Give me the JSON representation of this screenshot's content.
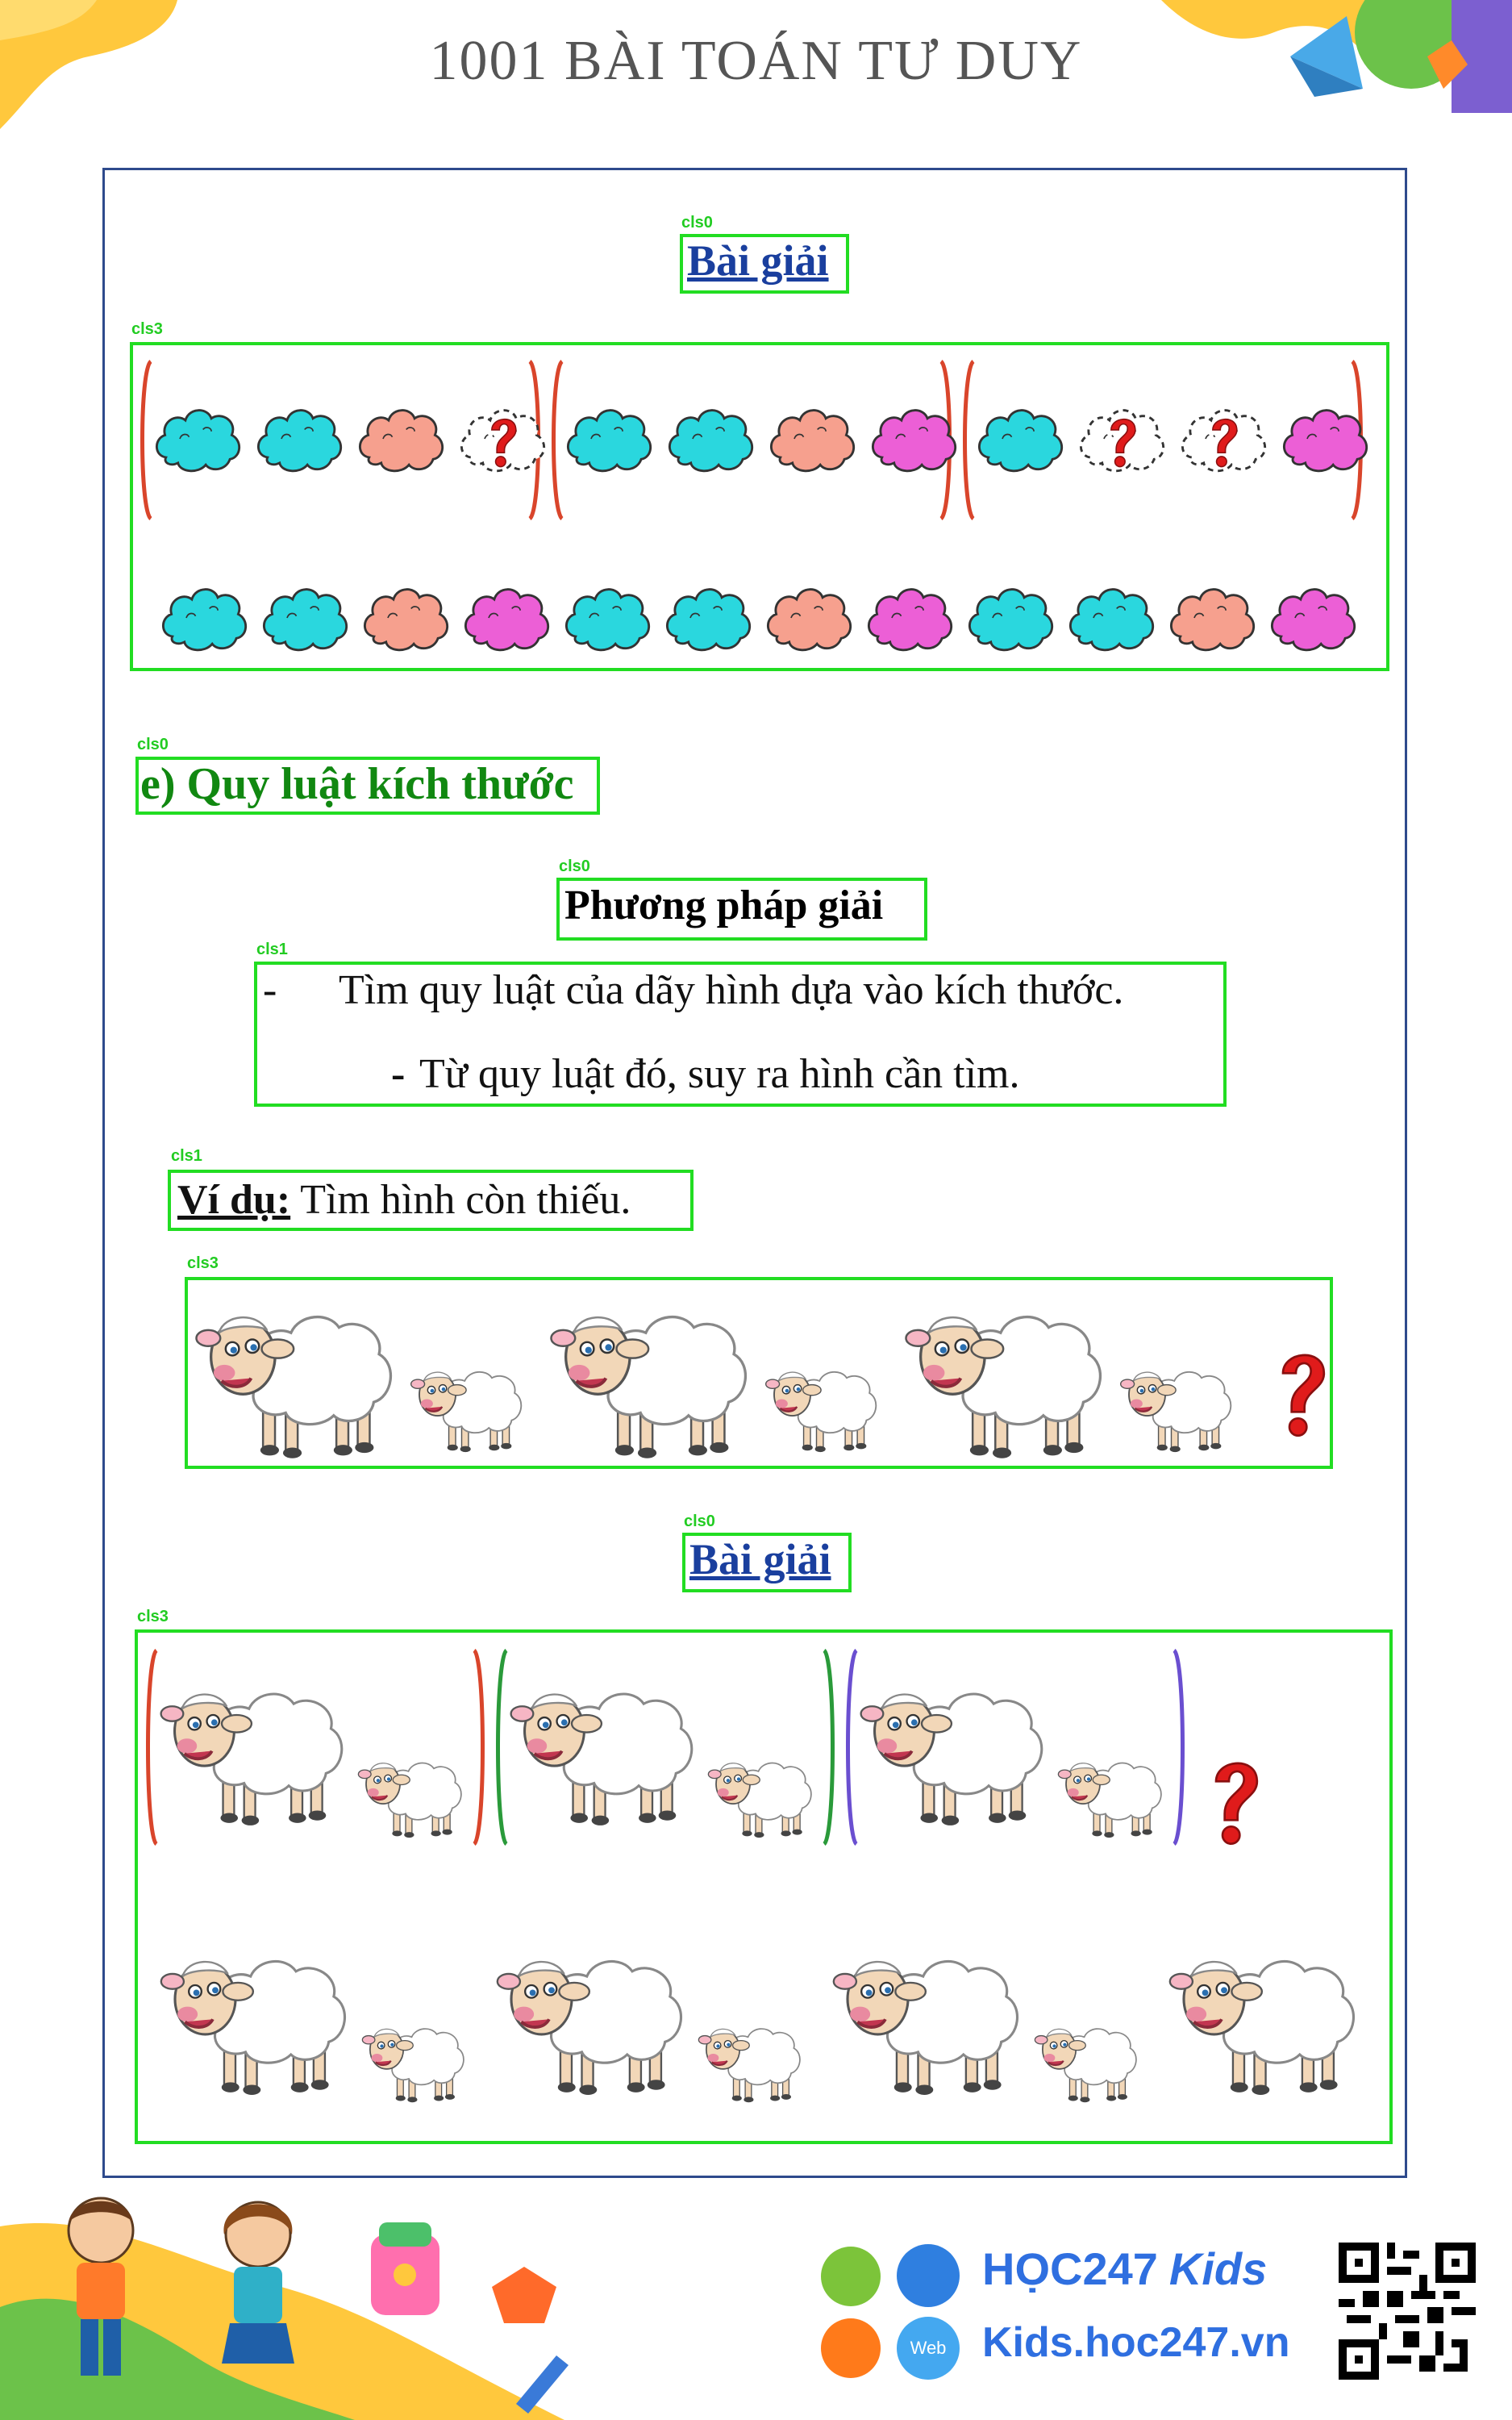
{
  "header": {
    "title": "1001 BÀI TOÁN TƯ DUY"
  },
  "section1": {
    "heading": "Bài giải"
  },
  "section2": {
    "heading": "e) Quy luật kích thước",
    "method_title": "Phương pháp giải",
    "steps": [
      {
        "bullet": "-",
        "text": "Tìm quy luật của dãy hình dựa vào kích thước."
      },
      {
        "bullet": "-",
        "text": "Từ quy luật đó, suy ra hình cần tìm."
      }
    ],
    "example_label": "Ví dụ:",
    "example_text": " Tìm hình còn thiếu.",
    "solution_heading": "Bài giải"
  },
  "box_labels": {
    "l0": "cls0",
    "l1": "cls3",
    "l2": "cls0",
    "l3": "cls0",
    "l4": "cls1",
    "l5": "cls1",
    "l6": "cls3",
    "l7": "cls0",
    "l8": "cls3"
  },
  "question_mark": "?",
  "footer": {
    "brand_prefix": "HỌC247",
    "brand_suffix": "Kids",
    "website": "Kids.hoc247.vn",
    "web_badge": "Web"
  },
  "colors": {
    "cyan": "#2ad7de",
    "salmon": "#f6a08e",
    "magenta": "#ec5fd6",
    "bracket_red": "#d9452b",
    "bracket_green": "#2a9a3a",
    "bracket_purple": "#6a4fd0",
    "box_green": "#22dd22"
  },
  "cloud_pattern": {
    "top_rows": [
      [
        "cyan",
        "cyan",
        "salmon",
        "?"
      ],
      [
        "cyan",
        "cyan",
        "salmon",
        "magenta"
      ],
      [
        "cyan",
        "?",
        "?",
        "magenta"
      ]
    ],
    "answer_row": [
      "cyan",
      "cyan",
      "salmon",
      "magenta",
      "cyan",
      "cyan",
      "salmon",
      "magenta",
      "cyan",
      "cyan",
      "salmon",
      "magenta"
    ]
  },
  "sheep_pattern": {
    "example": [
      "big",
      "small",
      "big",
      "small",
      "big",
      "small",
      "?"
    ],
    "solution_groups": [
      [
        "big",
        "small"
      ],
      [
        "big",
        "small"
      ],
      [
        "big",
        "small"
      ]
    ],
    "solution_answer": [
      "big",
      "small",
      "big",
      "small",
      "big",
      "small",
      "big"
    ]
  }
}
